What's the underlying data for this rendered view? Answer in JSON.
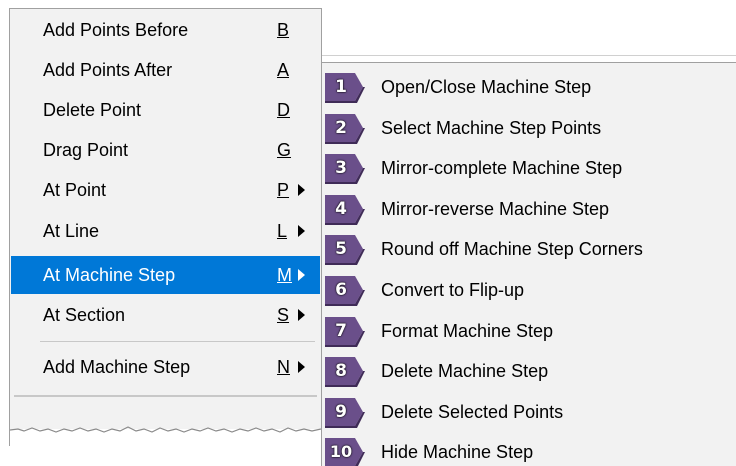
{
  "menu": {
    "items": [
      {
        "label": "Add Points Before",
        "shortcut": "B",
        "submenu": false
      },
      {
        "label": "Add Points After",
        "shortcut": "A",
        "submenu": false
      },
      {
        "label": "Delete Point",
        "shortcut": "D",
        "submenu": false
      },
      {
        "label": "Drag Point",
        "shortcut": "G",
        "submenu": false
      },
      {
        "label": "At Point",
        "shortcut": "P",
        "submenu": true
      },
      {
        "label": "At Line",
        "shortcut": "L",
        "submenu": true
      },
      {
        "label": "At Machine Step",
        "shortcut": "M",
        "submenu": true,
        "highlighted": true
      },
      {
        "label": "At Section",
        "shortcut": "S",
        "submenu": true
      },
      {
        "label": "Add Machine Step",
        "shortcut": "N",
        "submenu": true
      }
    ]
  },
  "submenu": {
    "items": [
      {
        "num": "1",
        "label": "Open/Close Machine Step"
      },
      {
        "num": "2",
        "label": "Select Machine Step Points"
      },
      {
        "num": "3",
        "label": "Mirror-complete Machine Step"
      },
      {
        "num": "4",
        "label": "Mirror-reverse Machine Step"
      },
      {
        "num": "5",
        "label": "Round off Machine Step Corners"
      },
      {
        "num": "6",
        "label": "Convert to Flip-up"
      },
      {
        "num": "7",
        "label": "Format Machine Step"
      },
      {
        "num": "8",
        "label": "Delete Machine Step"
      },
      {
        "num": "9",
        "label": "Delete Selected Points"
      },
      {
        "num": "10",
        "label": "Hide Machine Step"
      }
    ]
  },
  "colors": {
    "menu_bg": "#f2f2f2",
    "highlight": "#0078d7",
    "badge_fill": "#6a4f8a",
    "badge_dark": "#3f2b57"
  },
  "icons": {
    "submenu_arrow": "triangle-right-icon",
    "badge": "number-badge-icon"
  }
}
